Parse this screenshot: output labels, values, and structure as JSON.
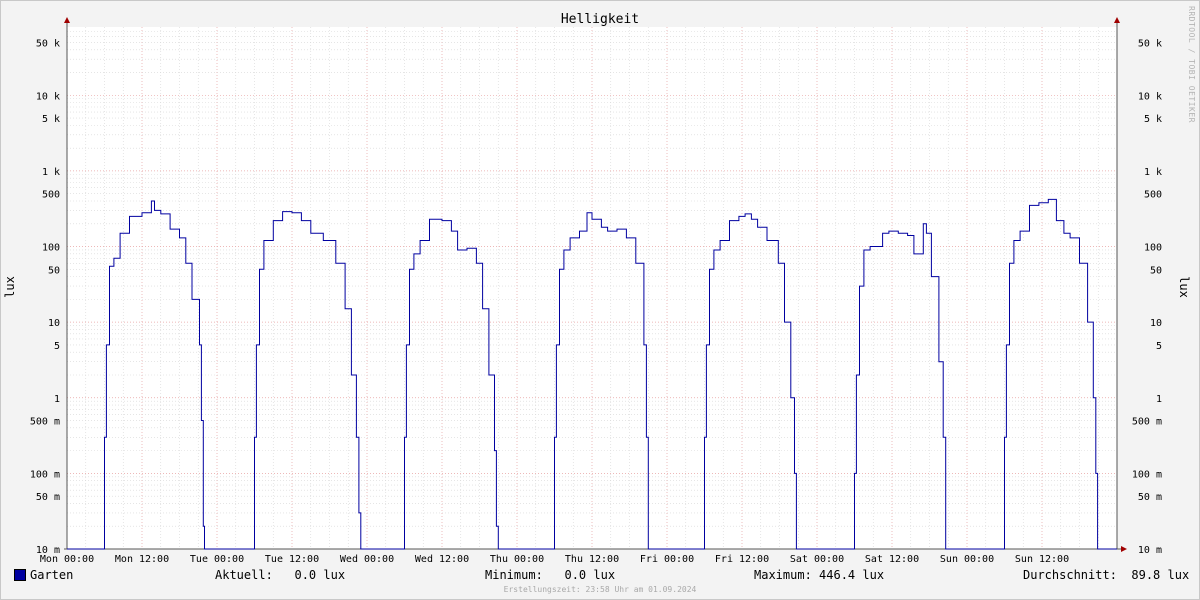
{
  "chart_data": {
    "type": "line",
    "title": "Helligkeit",
    "ylabel": "lux",
    "yscale": "log",
    "ylim": [
      0.01,
      80000
    ],
    "xlim": [
      0,
      168
    ],
    "x_tick_labels": [
      "Mon 00:00",
      "Mon 12:00",
      "Tue 00:00",
      "Tue 12:00",
      "Wed 00:00",
      "Wed 12:00",
      "Thu 00:00",
      "Thu 12:00",
      "Fri 00:00",
      "Fri 12:00",
      "Sat 00:00",
      "Sat 12:00",
      "Sun 00:00",
      "Sun 12:00"
    ],
    "x_tick_hours": [
      0,
      12,
      24,
      36,
      48,
      60,
      72,
      84,
      96,
      108,
      120,
      132,
      144,
      156
    ],
    "y_ticks": [
      {
        "value": 50000,
        "label": "50 k"
      },
      {
        "value": 10000,
        "label": "10 k"
      },
      {
        "value": 5000,
        "label": "5 k"
      },
      {
        "value": 1000,
        "label": "1 k"
      },
      {
        "value": 500,
        "label": "500"
      },
      {
        "value": 100,
        "label": "100"
      },
      {
        "value": 50,
        "label": "50"
      },
      {
        "value": 10,
        "label": "10"
      },
      {
        "value": 5,
        "label": "5"
      },
      {
        "value": 1,
        "label": "1"
      },
      {
        "value": 0.5,
        "label": "500 m"
      },
      {
        "value": 0.1,
        "label": "100 m"
      },
      {
        "value": 0.05,
        "label": "50 m"
      },
      {
        "value": 0.01,
        "label": "10 m"
      }
    ],
    "grid": true,
    "series": [
      {
        "name": "Garten",
        "color": "#0000a0",
        "x": [
          0,
          5.8,
          6.0,
          6.3,
          6.8,
          7.5,
          8.5,
          10,
          12,
          13.5,
          14,
          15,
          16.5,
          18,
          19,
          20,
          21.2,
          21.5,
          21.8,
          22.0,
          22.5,
          24,
          29.8,
          30.0,
          30.3,
          30.8,
          31.5,
          33,
          34.5,
          36,
          37.5,
          39,
          41,
          43,
          44.5,
          45.5,
          46.3,
          46.7,
          47.0,
          47.3,
          48,
          53.8,
          54.0,
          54.3,
          54.8,
          55.5,
          56.5,
          58,
          60,
          61.5,
          62.5,
          64,
          65.5,
          66.5,
          67.5,
          68.4,
          68.7,
          69.0,
          69.5,
          72,
          77.8,
          78.0,
          78.3,
          78.8,
          79.5,
          80.5,
          82,
          83.2,
          84,
          85.5,
          86.5,
          88,
          89.5,
          91,
          92.3,
          92.7,
          93.0,
          93.3,
          96,
          101.8,
          102.0,
          102.3,
          102.8,
          103.5,
          104.5,
          106,
          107.5,
          108.5,
          109.5,
          110.5,
          112,
          113.8,
          114.8,
          115.8,
          116.4,
          116.7,
          117.0,
          120,
          125.8,
          126.0,
          126.3,
          126.8,
          127.5,
          128.5,
          130.5,
          131.5,
          133,
          134.5,
          135.5,
          136.5,
          137.0,
          137.5,
          138.3,
          139.5,
          140.2,
          140.6,
          140.9,
          141.3,
          144,
          149.8,
          150.0,
          150.3,
          150.8,
          151.5,
          152.5,
          154,
          155.5,
          157,
          158.3,
          159.5,
          160.5,
          162,
          163.3,
          164.2,
          164.6,
          164.9,
          165.3,
          168
        ],
        "values": [
          0.01,
          0.01,
          0.3,
          5,
          55,
          70,
          150,
          250,
          280,
          400,
          300,
          270,
          170,
          130,
          60,
          20,
          5,
          0.5,
          0.02,
          0.01,
          0.01,
          0.01,
          0.01,
          0.3,
          5,
          50,
          120,
          220,
          290,
          280,
          220,
          150,
          120,
          60,
          15,
          2,
          0.3,
          0.03,
          0.01,
          0.01,
          0.01,
          0.01,
          0.3,
          5,
          50,
          80,
          120,
          230,
          220,
          160,
          90,
          95,
          60,
          15,
          2,
          0.2,
          0.02,
          0.01,
          0.01,
          0.01,
          0.01,
          0.3,
          5,
          50,
          90,
          130,
          160,
          280,
          230,
          180,
          160,
          170,
          130,
          60,
          5,
          0.3,
          0.01,
          0.01,
          0.01,
          0.01,
          0.3,
          5,
          50,
          90,
          120,
          220,
          250,
          270,
          230,
          180,
          120,
          60,
          10,
          1,
          0.1,
          0.01,
          0.01,
          0.01,
          0.01,
          0.1,
          2,
          30,
          90,
          100,
          150,
          160,
          150,
          140,
          80,
          80,
          200,
          150,
          40,
          3,
          0.3,
          0.01,
          0.01,
          0.01,
          0.01,
          0.01,
          0.3,
          5,
          60,
          120,
          160,
          350,
          380,
          420,
          220,
          150,
          130,
          60,
          10,
          1,
          0.1,
          0.01,
          0.01,
          0.01
        ]
      }
    ]
  },
  "legend": {
    "series_name": "Garten",
    "aktuell": "Aktuell:   0.0 lux",
    "minimum": "Minimum:   0.0 lux",
    "maximum": "Maximum: 446.4 lux",
    "durchschnitt": "Durchschnitt:  89.8 lux"
  },
  "footer": "Erstellungszeit: 23:58 Uhr am 01.09.2024",
  "side_watermark": "RRDTOOL / TOBI OETIKER"
}
